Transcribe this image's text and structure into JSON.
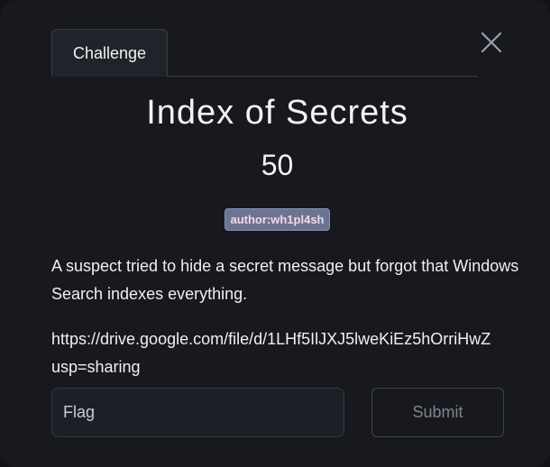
{
  "modal": {
    "tab_label": "Challenge",
    "title": "Index of Secrets",
    "points": "50",
    "author_badge": "author:wh1pl4sh",
    "description": "A suspect tried to hide a secret message but forgot that Windows Search indexes everything.",
    "link_line1": "https://drive.google.com/file/d/1LHf5IlJXJ5lweKiEz5hOrriHwZ",
    "link_line2": "usp=sharing",
    "flag_placeholder": "Flag",
    "submit_label": "Submit"
  },
  "icons": {
    "close": "close-icon"
  },
  "colors": {
    "modal_bg": "#17191f",
    "badge_bg": "#6b7493",
    "badge_text": "#f6d9e4",
    "text": "#eef0f3"
  }
}
